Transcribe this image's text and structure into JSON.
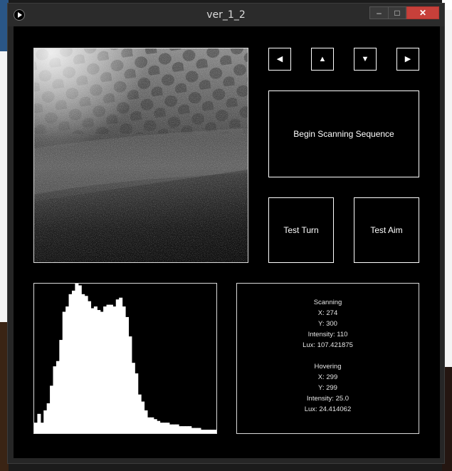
{
  "window": {
    "title": "ver_1_2",
    "controls": {
      "minimize": "–",
      "maximize": "□",
      "close": "✕"
    }
  },
  "colors": {
    "background": "#000000",
    "panel_border": "#ffffff",
    "close_button": "#c7403a",
    "text": "#e6e6e6"
  },
  "nav_buttons": [
    {
      "name": "left",
      "glyph": "◀"
    },
    {
      "name": "up",
      "glyph": "▲"
    },
    {
      "name": "down",
      "glyph": "▼"
    },
    {
      "name": "right",
      "glyph": "▶"
    }
  ],
  "buttons": {
    "begin_scan": "Begin Scanning Sequence",
    "test_turn": "Test Turn",
    "test_aim": "Test Aim"
  },
  "image_preview": {
    "description": "grayscale camera capture",
    "icon": "camera-image"
  },
  "histogram": {
    "bins": [
      6,
      11,
      6,
      13,
      17,
      27,
      38,
      41,
      53,
      69,
      72,
      79,
      81,
      85,
      84,
      79,
      78,
      75,
      71,
      72,
      70,
      69,
      72,
      73,
      73,
      72,
      76,
      77,
      72,
      66,
      55,
      40,
      34,
      22,
      18,
      13,
      9,
      9,
      8,
      7,
      6,
      6,
      6,
      5,
      5,
      5,
      4,
      4,
      4,
      4,
      3,
      3,
      3,
      2,
      2,
      2,
      2,
      2
    ]
  },
  "info": {
    "scanning": {
      "heading": "Scanning",
      "x": "X: 274",
      "y": "Y: 300",
      "intensity": "Intensity: 110",
      "lux": "Lux: 107.421875"
    },
    "hovering": {
      "heading": "Hovering",
      "x": "X: 299",
      "y": "Y: 299",
      "intensity": "Intensity: 25.0",
      "lux": "Lux: 24.414062"
    }
  }
}
